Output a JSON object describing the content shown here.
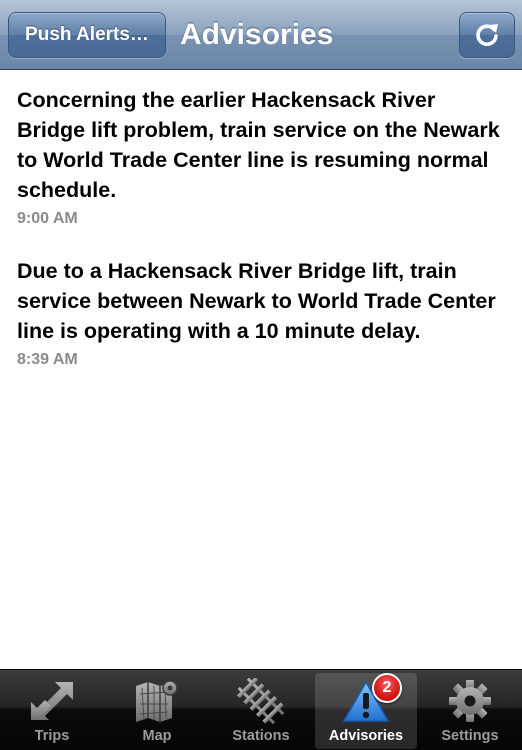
{
  "navbar": {
    "title": "Advisories",
    "left_button": "Push Alerts…",
    "right_button_icon": "refresh-icon"
  },
  "advisories": [
    {
      "text": "Concerning the earlier Hackensack River Bridge lift problem, train service on the Newark to World Trade Center line is resuming normal schedule.",
      "time": "9:00 AM"
    },
    {
      "text": "Due to a Hackensack River Bridge lift, train service between Newark to World Trade Center line is operating with a 10 minute delay.",
      "time": "8:39 AM"
    }
  ],
  "tabs": [
    {
      "label": "Trips",
      "icon": "trips-arrows-icon",
      "active": false
    },
    {
      "label": "Map",
      "icon": "map-icon",
      "active": false
    },
    {
      "label": "Stations",
      "icon": "railroad-tracks-icon",
      "active": false
    },
    {
      "label": "Advisories",
      "icon": "warning-icon",
      "active": true,
      "badge": "2"
    },
    {
      "label": "Settings",
      "icon": "gear-icon",
      "active": false
    }
  ],
  "colors": {
    "navbar": "#7a93b3",
    "timestamp": "#8a8a8a",
    "badge": "#d61717",
    "active_tab_icon": "#2f8fe6"
  }
}
